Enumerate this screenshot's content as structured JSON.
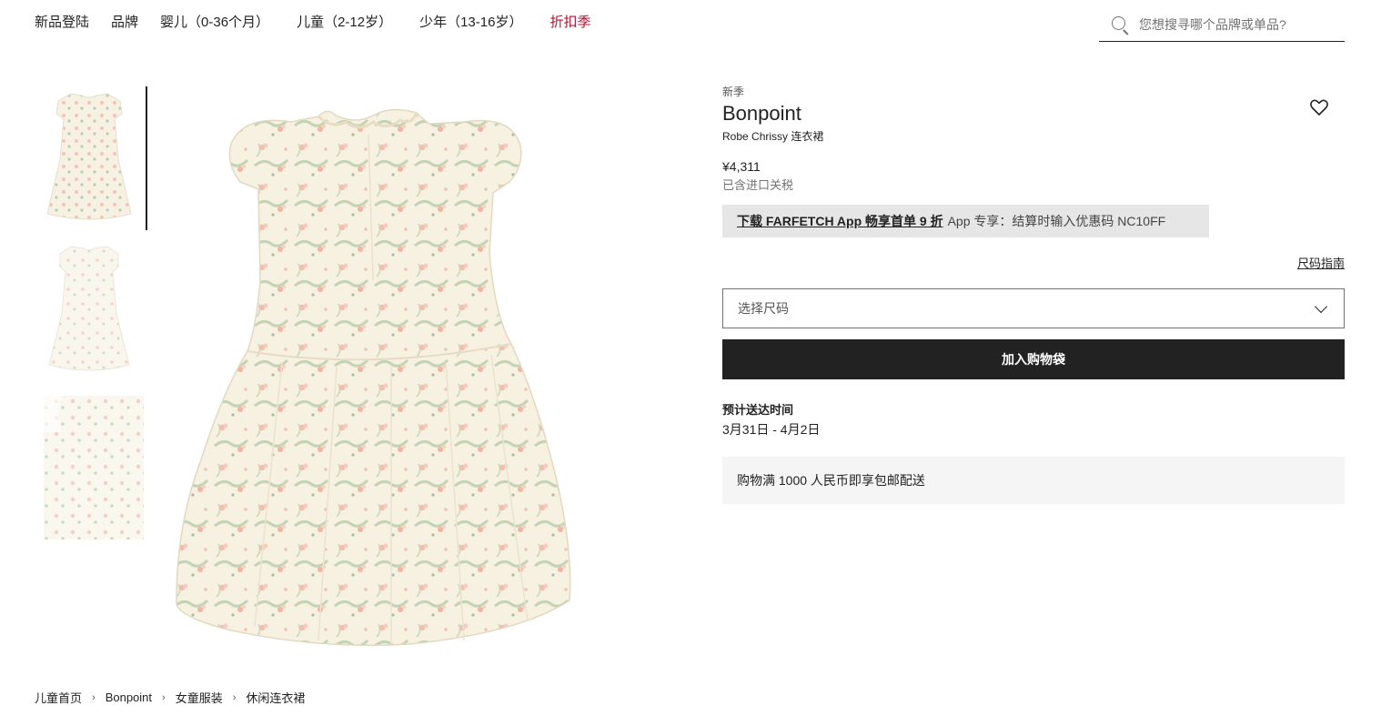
{
  "nav": {
    "items": [
      {
        "label": "新品登陆"
      },
      {
        "label": "品牌"
      },
      {
        "label": "婴儿（0-36个月）"
      },
      {
        "label": "儿童（2-12岁）"
      },
      {
        "label": "少年（13-16岁）"
      },
      {
        "label": "折扣季"
      }
    ],
    "sale_color": "#b3122f"
  },
  "search": {
    "placeholder": "您想搜寻哪个品牌或单品?",
    "icon": "search-icon"
  },
  "gallery": {
    "thumbnails": [
      {
        "label": "dress-front",
        "active": true
      },
      {
        "label": "dress-back",
        "active": false
      },
      {
        "label": "dress-detail",
        "active": false
      }
    ]
  },
  "product": {
    "season": "新季",
    "brand": "Bonpoint",
    "name": "Robe Chrissy 连衣裙",
    "price": "¥4,311",
    "tax_note": "已含进口关税",
    "wishlist_icon": "heart-icon"
  },
  "promo": {
    "link": "下载 FARFETCH App 畅享首单 9 折",
    "text": "App 专享：结算时输入优惠码 NC10FF"
  },
  "size": {
    "guide_label": "尺码指南",
    "select_label": "选择尺码"
  },
  "cart": {
    "add_label": "加入购物袋"
  },
  "delivery": {
    "title": "预计送达时间",
    "dates": "3月31日 - 4月2日"
  },
  "shipping": {
    "text": "购物满 1000 人民币即享包邮配送"
  },
  "breadcrumb": {
    "items": [
      "儿童首页",
      "Bonpoint",
      "女童服装",
      "休闲连衣裙"
    ],
    "separator": "›"
  },
  "colors": {
    "primary": "#222222",
    "sale": "#b3122f",
    "promo_bg": "#e6e6e6",
    "shipping_bg": "#f5f5f5"
  }
}
